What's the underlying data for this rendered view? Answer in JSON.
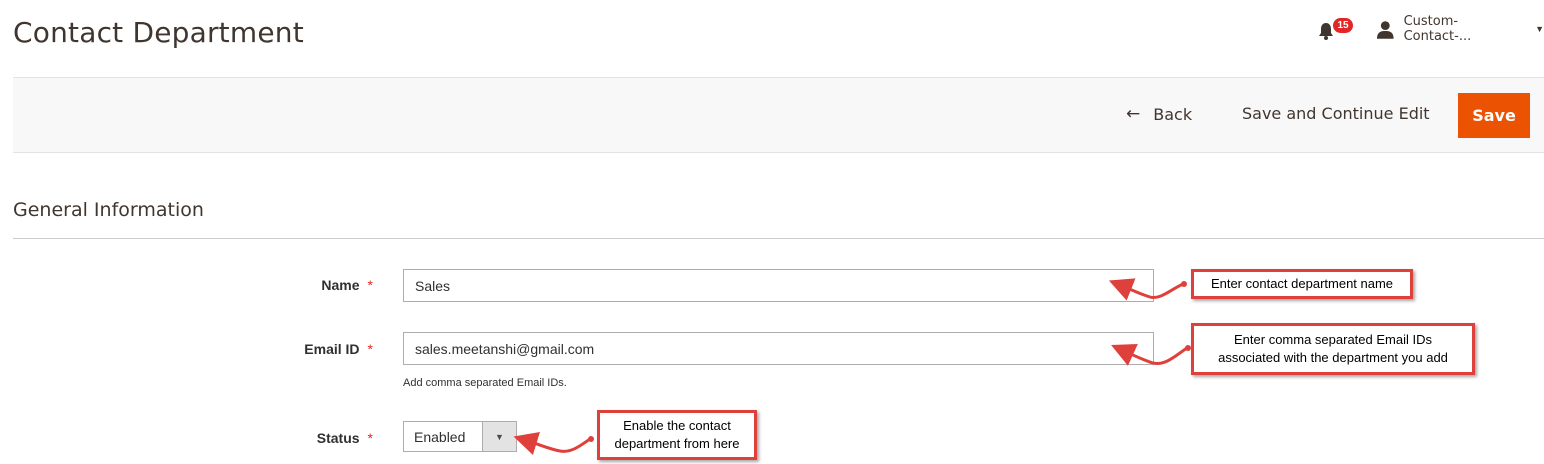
{
  "header": {
    "title": "Contact Department",
    "notifications_count": "15",
    "user_name": "Custom-Contact-...",
    "icons": {
      "notifications": "bell-icon",
      "user": "user-icon",
      "menu": "caret-down-icon"
    }
  },
  "actions": {
    "back_label": "Back",
    "save_continue_label": "Save and Continue Edit",
    "save_label": "Save"
  },
  "section": {
    "title": "General Information"
  },
  "form": {
    "name": {
      "label": "Name",
      "value": "Sales"
    },
    "email": {
      "label": "Email ID",
      "value": "sales.meetanshi@gmail.com",
      "note": "Add comma separated Email IDs."
    },
    "status": {
      "label": "Status",
      "value": "Enabled"
    },
    "required_marker": "*"
  },
  "annotations": {
    "name": "Enter contact department name",
    "email_line1": "Enter comma separated Email IDs",
    "email_line2": "associated with the department you add",
    "status_line1": "Enable the contact",
    "status_line2": "department from here"
  },
  "colors": {
    "accent": "#eb5202",
    "required": "#e22626",
    "callout_border": "#e0403c"
  }
}
